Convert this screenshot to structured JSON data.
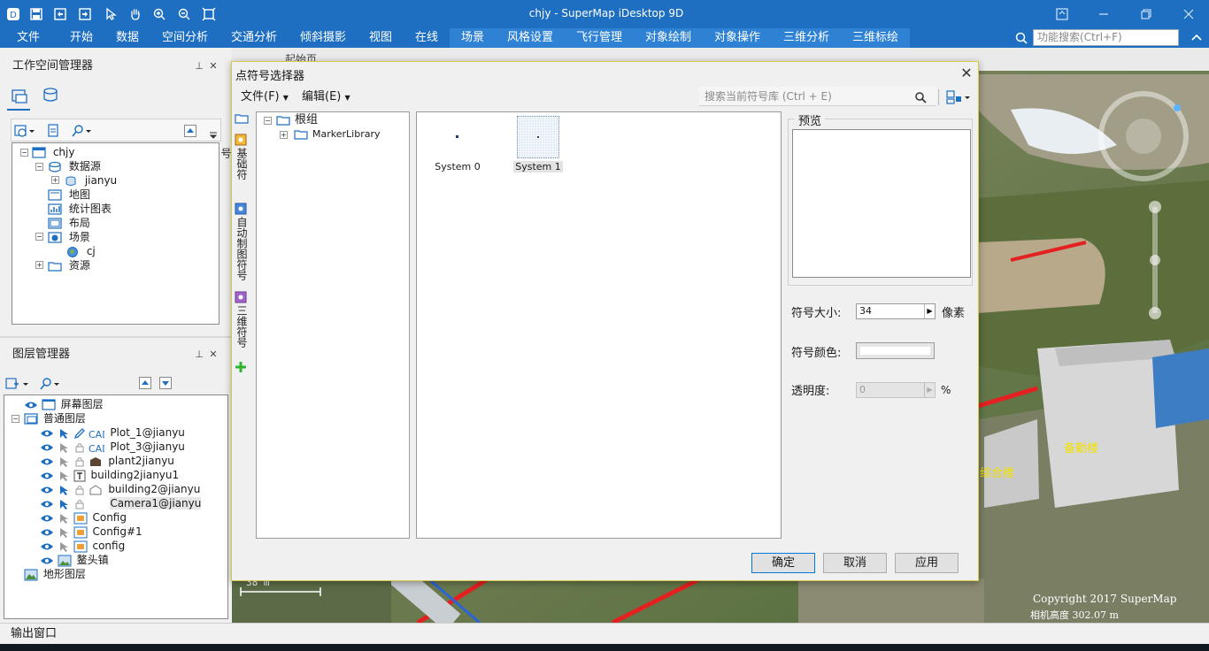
{
  "app": {
    "window_title": "chjy - SuperMap iDesktop 9D",
    "quick_access_icons": [
      "app-logo-icon",
      "save-icon",
      "open-icon",
      "close-file-icon",
      "select-arrow-icon",
      "pan-hand-icon",
      "zoom-in-icon",
      "zoom-out-icon",
      "full-extent-icon"
    ],
    "accent_color": "#1e6fc2"
  },
  "menu": {
    "items": [
      "文件",
      "开始",
      "数据",
      "空间分析",
      "交通分析",
      "倾斜摄影",
      "视图",
      "在线",
      "场景",
      "风格设置",
      "飞行管理",
      "对象绘制",
      "对象操作",
      "三维分析",
      "三维标绘"
    ],
    "search_placeholder": "功能搜索(Ctrl+F)"
  },
  "workspace_manager": {
    "title": "工作空间管理器",
    "tree": {
      "root": "chjy",
      "datasources": "数据源",
      "datasource_item": "jianyu",
      "maps": "地图",
      "charts": "统计图表",
      "layouts": "布局",
      "scenes": "场景",
      "scene_item": "cj",
      "resources": "资源"
    }
  },
  "layer_manager": {
    "title": "图层管理器",
    "screen_layer": "屏幕图层",
    "normal_layer": "普通图层",
    "layers": [
      "Plot_1@jianyu",
      "Plot_3@jianyu",
      "plant2jianyu",
      "building2jianyu1",
      "building2@jianyu",
      "Camera1@jianyu",
      "Config",
      "Config#1",
      "config",
      "鳌头镇"
    ],
    "selected_layer": "Camera1@jianyu",
    "terrain_layer": "地形图层"
  },
  "scene_view": {
    "tab_title": "起始页",
    "scale_label": "38 m",
    "labels": [
      "备勤楼",
      "综合楼"
    ],
    "copyright": "Copyright 2017 SuperMap",
    "camera_altitude": "相机高度 302.07 m"
  },
  "output_window": {
    "title": "输出窗口"
  },
  "dialog": {
    "title": "点符号选择器",
    "menu_file": "文件(F)",
    "menu_edit": "编辑(E)",
    "search_placeholder": "搜索当前符号库 (Ctrl + E)",
    "side_tabs": [
      "基础符号",
      "自动制图符号",
      "三维符号"
    ],
    "tree_root": "根组",
    "tree_child": "MarkerLibrary",
    "symbols": [
      "System 0",
      "System 1"
    ],
    "selected_symbol": "System 1",
    "preview_label": "预览",
    "size_label": "符号大小:",
    "size_value": "34",
    "size_unit": "像素",
    "color_label": "符号颜色:",
    "opacity_label": "透明度:",
    "opacity_value": "0",
    "opacity_unit": "%",
    "ok": "确定",
    "cancel": "取消",
    "apply": "应用"
  }
}
